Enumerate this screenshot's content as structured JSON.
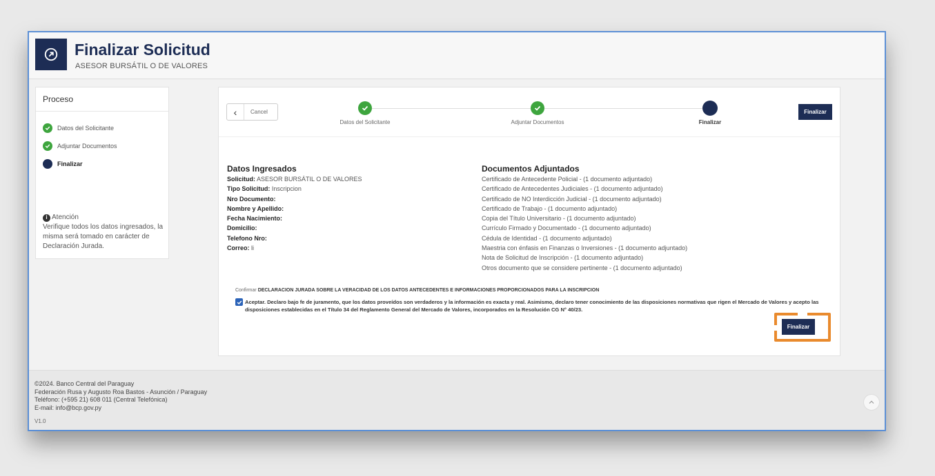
{
  "header": {
    "title": "Finalizar Solicitud",
    "subtitle": "ASESOR BURSÁTIL O DE VALORES",
    "icon": "arrow-up-right-circle-icon"
  },
  "sidebar": {
    "title": "Proceso",
    "steps": [
      {
        "label": "Datos del Solicitante",
        "status": "done"
      },
      {
        "label": "Adjuntar Documentos",
        "status": "done"
      },
      {
        "label": "Finalizar",
        "status": "current"
      }
    ],
    "attention": {
      "title": "Atención",
      "text": "Verifique todos los datos ingresados, la misma será tomado en carácter de Declaración Jurada."
    }
  },
  "wizard": {
    "cancel_label": "Cancel",
    "steps": [
      {
        "label": "Datos del Solicitante",
        "status": "done"
      },
      {
        "label": "Adjuntar Documentos",
        "status": "done"
      },
      {
        "label": "Finalizar",
        "status": "current"
      }
    ],
    "finalize_label": "Finalizar"
  },
  "datos": {
    "title": "Datos Ingresados",
    "fields": [
      {
        "label": "Solicitud:",
        "value": "ASESOR BURSÁTIL O DE VALORES"
      },
      {
        "label": "Tipo Solicitud:",
        "value": "Inscripcion"
      },
      {
        "label": "Nro Documento:",
        "value": ""
      },
      {
        "label": "Nombre y Apellido:",
        "value": ""
      },
      {
        "label": "Fecha Nacimiento:",
        "value": ""
      },
      {
        "label": "Domicilio:",
        "value": ""
      },
      {
        "label": "Telefono Nro:",
        "value": ""
      },
      {
        "label": "Correo:",
        "value": "li"
      }
    ]
  },
  "documentos": {
    "title": "Documentos Adjuntados",
    "items": [
      "Certificado de Antecedente Policial - (1 documento adjuntado)",
      "Certificado de Antecedentes Judiciales - (1 documento adjuntado)",
      "Certificado de NO Interdicción Judicial - (1 documento adjuntado)",
      "Certificado de Trabajo - (1 documento adjuntado)",
      "Copia del Título Universitario - (1 documento adjuntado)",
      "Currículo Firmado y Documentado - (1 documento adjuntado)",
      "Cédula de Identidad - (1 documento adjuntado)",
      "Maestria con énfasis en Finanzas o Inversiones - (1 documento adjuntado)",
      "Nota de Solicitud de Inscripción - (1 documento adjuntado)",
      "Otros documento que se considere pertinente - (1 documento adjuntado)"
    ]
  },
  "confirm": {
    "prefix": "Confirmar",
    "title": "DECLARACION JURADA SOBRE LA VERACIDAD DE LOS DATOS ANTECEDENTES E INFORMACIONES PROPORCIONADOS PARA LA INSCRIPCION",
    "accept_text": "Aceptar. Declaro bajo fe de juramento, que los datos proveídos son verdaderos y la información es exacta y real. Asimismo, declaro tener conocimiento de las disposiciones normativas que rigen el Mercado de Valores y acepto las disposiciones establecidas en el Título 34 del Reglamento General del Mercado de Valores, incorporados en la Resolución CG N° 40/23.",
    "checked": true,
    "finalize_label": "Finalizar"
  },
  "footer": {
    "lines": [
      "©2024. Banco Central del Paraguay",
      "Federación Rusa y Augusto Roa Bastos - Asunción / Paraguay",
      "Teléfono: (+595 21) 608 011 (Central Telefónica)",
      "E-mail: info@bcp.gov.py"
    ],
    "version": "V1.0"
  },
  "colors": {
    "brand": "#1d2d55",
    "success": "#3ea53e",
    "highlight": "#e98a2d",
    "checkbox": "#2a62b8"
  }
}
